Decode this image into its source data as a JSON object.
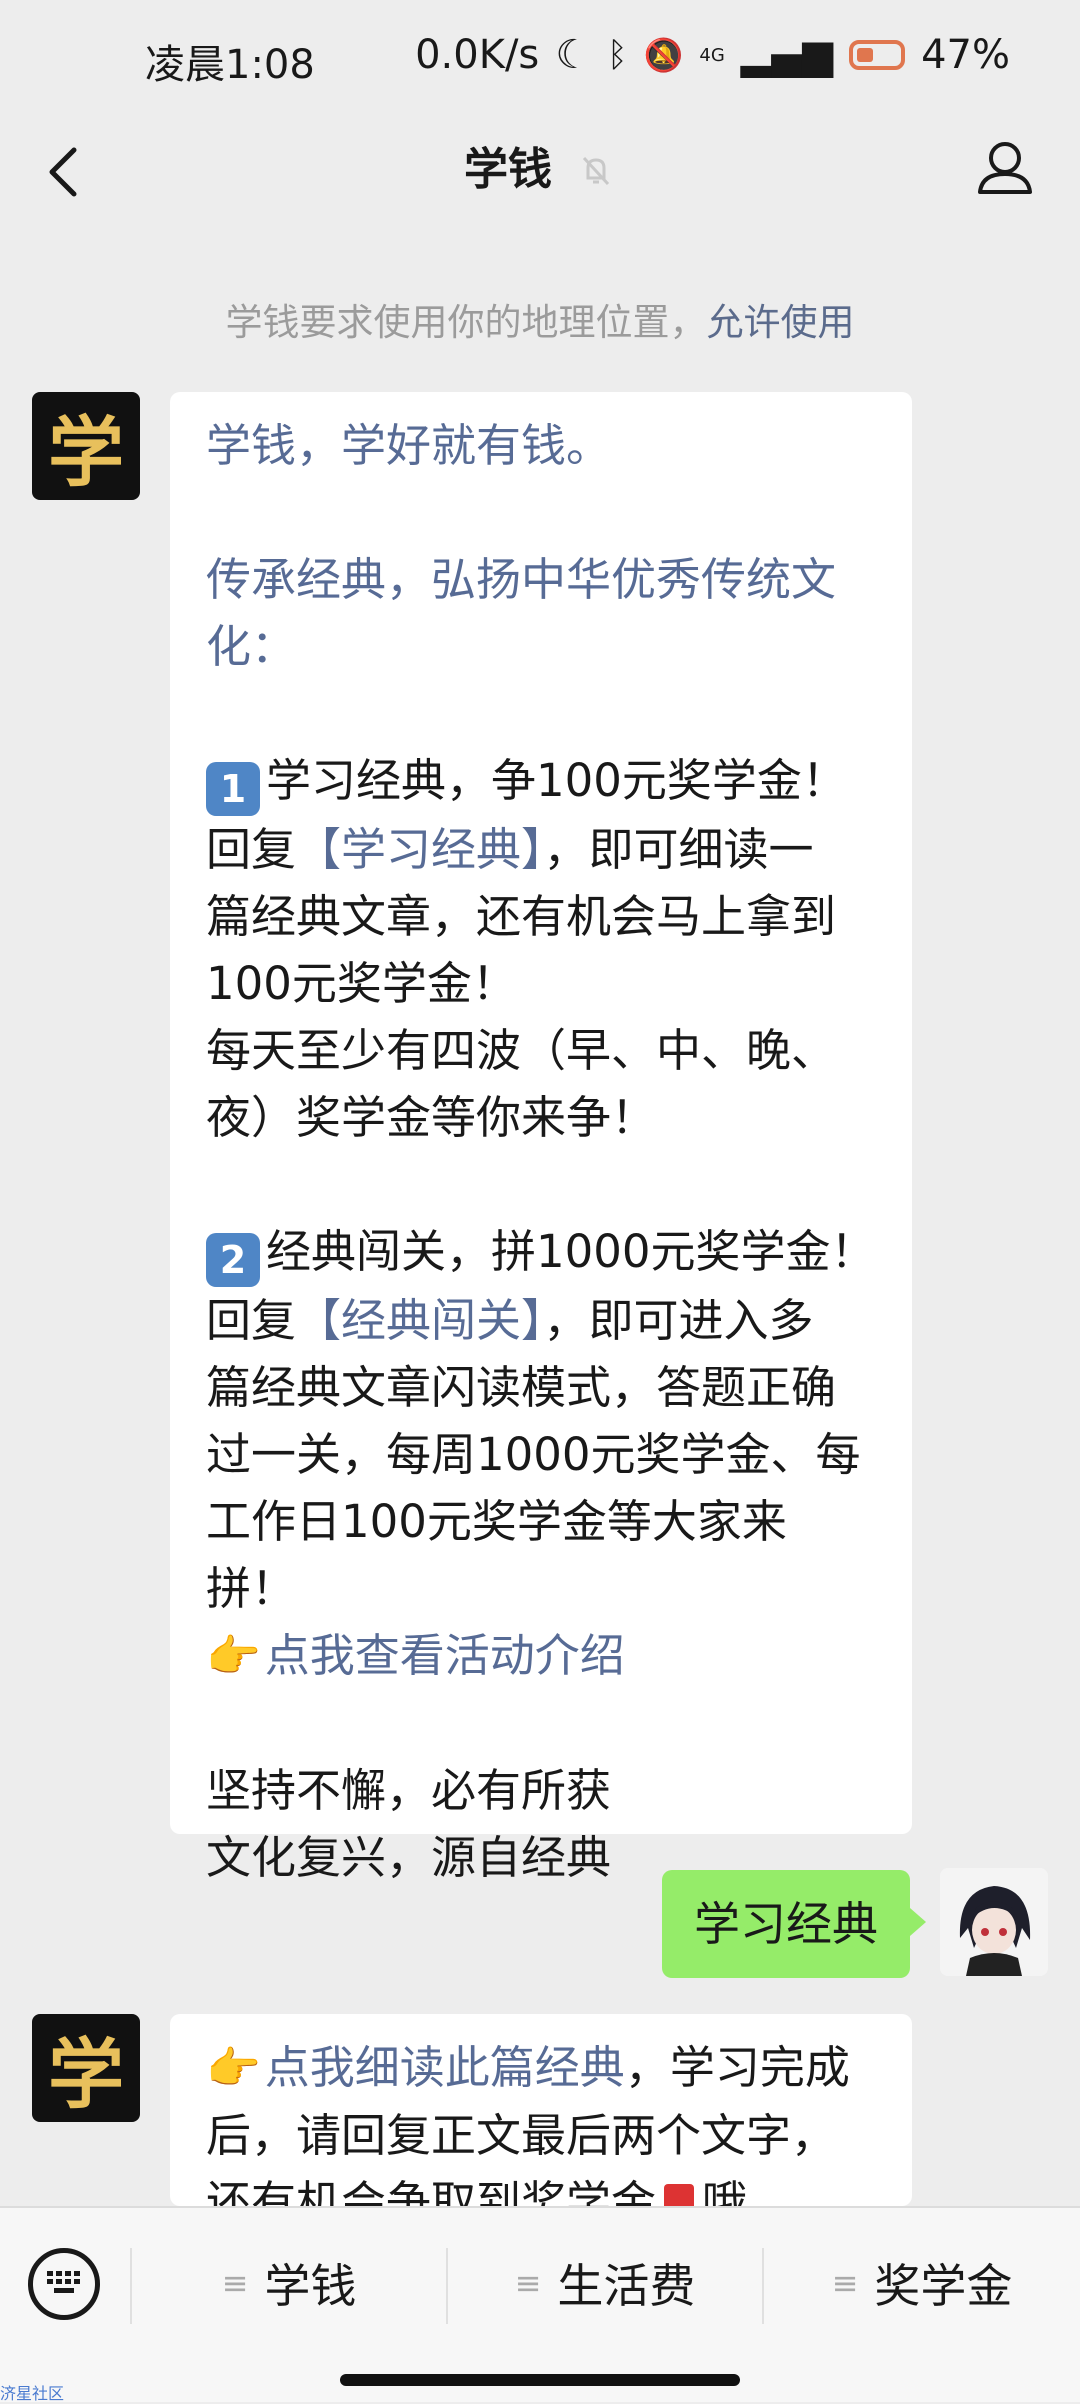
{
  "status": {
    "time": "凌晨1:08",
    "speed": "0.0K/s",
    "network": "4G",
    "battery": "47%"
  },
  "header": {
    "title": "学钱"
  },
  "system_message": {
    "text": "学钱要求使用你的地理位置，",
    "action": "允许使用"
  },
  "bot": {
    "avatar_char": "学"
  },
  "message1": {
    "l1": "学钱，学好就有钱。",
    "l2": "传承经典，弘扬中华优秀传统文",
    "l3": "化：",
    "item1_badge": "1",
    "item1_title": "学习经典，争100元奖学金！",
    "item1_reply_prefix": "回复",
    "item1_keyword": "【学习经典】",
    "item1_reply_suffix": "，即可细读一",
    "item1_l3": "篇经典文章，还有机会马上拿到",
    "item1_l4": "100元奖学金！",
    "item1_l5": "每天至少有四波（早、中、晚、",
    "item1_l6": "夜）奖学金等你来争！",
    "item2_badge": "2",
    "item2_title": "经典闯关，拼1000元奖学金！",
    "item2_reply_prefix": "回复",
    "item2_keyword": "【经典闯关】",
    "item2_reply_suffix": "，即可进入多",
    "item2_l3": "篇经典文章闪读模式，答题正确",
    "item2_l4": "过一关，每周1000元奖学金、每",
    "item2_l5": "工作日100元奖学金等大家来拼！",
    "activity_link": "点我查看活动介绍",
    "closing1": "坚持不懈，必有所获",
    "closing2": "文化复兴，源自经典"
  },
  "my_message": {
    "text": "学习经典"
  },
  "message2": {
    "link": "点我细读此篇经典",
    "l1_suffix": "，学习完成",
    "l2": "后，请回复正文最后两个文字，",
    "l3": "还有机会争取到奖学金",
    "l3_end": "哦"
  },
  "bottom_menu": {
    "items": [
      "学钱",
      "生活费",
      "奖学金"
    ]
  },
  "watermark": "济星社区"
}
